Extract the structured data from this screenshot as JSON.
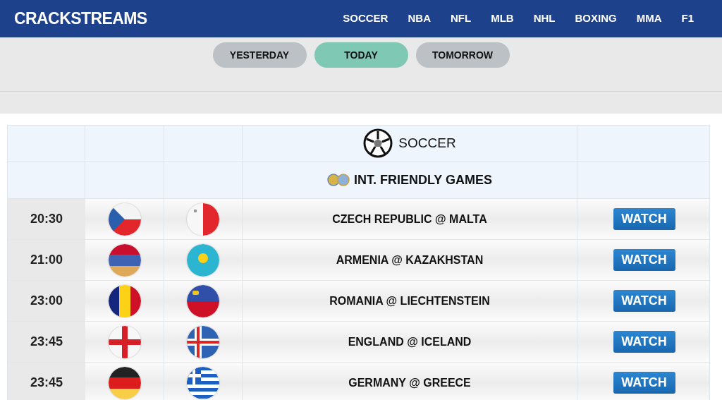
{
  "site": {
    "logo": "CRACKSTREAMS"
  },
  "nav": [
    "SOCCER",
    "NBA",
    "NFL",
    "MLB",
    "NHL",
    "BOXING",
    "MMA",
    "F1"
  ],
  "days": [
    {
      "label": "YESTERDAY",
      "selected": false
    },
    {
      "label": "TODAY",
      "selected": true
    },
    {
      "label": "TOMORROW",
      "selected": false
    }
  ],
  "table": {
    "sport": "SOCCER",
    "league": "INT. FRIENDLY GAMES",
    "rows": [
      {
        "time": "20:30",
        "match": "CZECH REPUBLIC @ MALTA",
        "button": "WATCH"
      },
      {
        "time": "21:00",
        "match": "ARMENIA @ KAZAKHSTAN",
        "button": "WATCH"
      },
      {
        "time": "23:00",
        "match": "ROMANIA @ LIECHTENSTEIN",
        "button": "WATCH"
      },
      {
        "time": "23:45",
        "match": "ENGLAND @ ICELAND",
        "button": "WATCH"
      },
      {
        "time": "23:45",
        "match": "GERMANY @ GREECE",
        "button": "WATCH"
      }
    ]
  }
}
